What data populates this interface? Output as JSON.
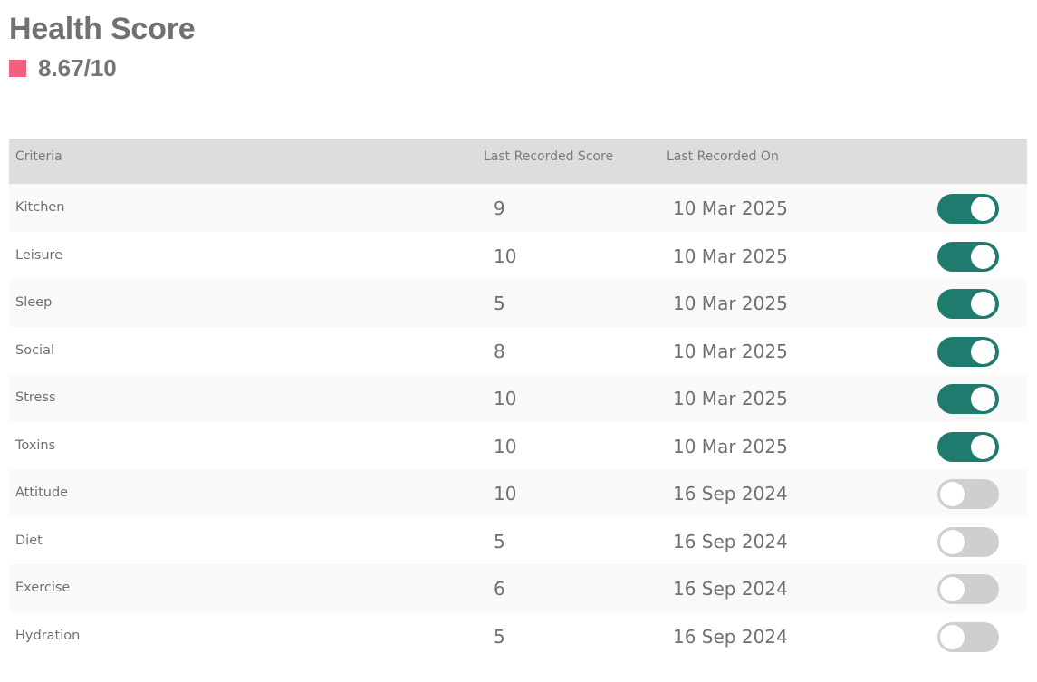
{
  "header": {
    "title": "Health Score",
    "score": "8.67/10",
    "score_color": "#f0607f"
  },
  "table": {
    "columns": {
      "criteria": "Criteria",
      "score": "Last Recorded Score",
      "date": "Last Recorded On"
    },
    "rows": [
      {
        "criteria": "Kitchen",
        "score": "9",
        "date": "10 Mar 2025",
        "enabled": true
      },
      {
        "criteria": "Leisure",
        "score": "10",
        "date": "10 Mar 2025",
        "enabled": true
      },
      {
        "criteria": "Sleep",
        "score": "5",
        "date": "10 Mar 2025",
        "enabled": true
      },
      {
        "criteria": "Social",
        "score": "8",
        "date": "10 Mar 2025",
        "enabled": true
      },
      {
        "criteria": "Stress",
        "score": "10",
        "date": "10 Mar 2025",
        "enabled": true
      },
      {
        "criteria": "Toxins",
        "score": "10",
        "date": "10 Mar 2025",
        "enabled": true
      },
      {
        "criteria": "Attitude",
        "score": "10",
        "date": "16 Sep 2024",
        "enabled": false
      },
      {
        "criteria": "Diet",
        "score": "5",
        "date": "16 Sep 2024",
        "enabled": false
      },
      {
        "criteria": "Exercise",
        "score": "6",
        "date": "16 Sep 2024",
        "enabled": false
      },
      {
        "criteria": "Hydration",
        "score": "5",
        "date": "16 Sep 2024",
        "enabled": false
      }
    ]
  },
  "colors": {
    "toggle_on": "#1f7b6e",
    "toggle_off": "#cfcfcf",
    "header_bg": "#dddddd"
  }
}
